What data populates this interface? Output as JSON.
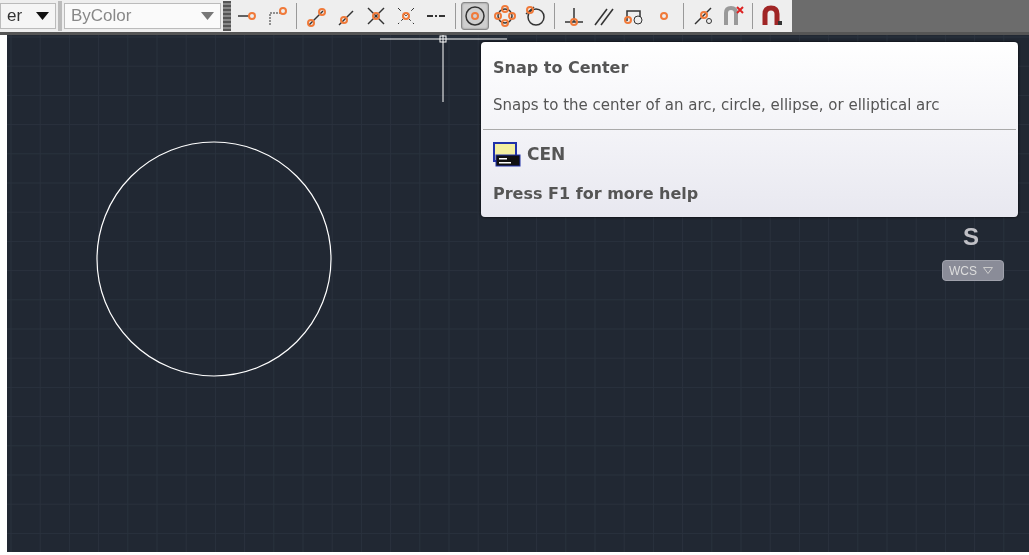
{
  "toolbar": {
    "layer_dropdown": {
      "value": "er"
    },
    "color_dropdown": {
      "value": "ByColor"
    },
    "snap_groups": [
      {
        "buttons": [
          {
            "kind": "endpoint",
            "selected": false
          },
          {
            "kind": "extension",
            "selected": false
          }
        ]
      },
      {
        "buttons": [
          {
            "kind": "midpoint",
            "selected": false
          },
          {
            "kind": "midpoint2",
            "selected": false
          },
          {
            "kind": "intersection",
            "selected": false
          },
          {
            "kind": "apparent",
            "selected": false
          },
          {
            "kind": "dashline",
            "selected": false
          }
        ]
      },
      {
        "buttons": [
          {
            "kind": "center",
            "selected": true
          },
          {
            "kind": "quadrant",
            "selected": false
          },
          {
            "kind": "tangent",
            "selected": false
          }
        ]
      },
      {
        "buttons": [
          {
            "kind": "perpendicular",
            "selected": false
          },
          {
            "kind": "parallel",
            "selected": false
          },
          {
            "kind": "insert",
            "selected": false
          },
          {
            "kind": "node",
            "selected": false
          }
        ]
      },
      {
        "buttons": [
          {
            "kind": "nearest",
            "selected": false
          },
          {
            "kind": "none",
            "selected": false
          }
        ]
      },
      {
        "buttons": [
          {
            "kind": "magnet",
            "selected": false
          }
        ]
      }
    ]
  },
  "tooltip": {
    "title": "Snap to Center",
    "description": "Snaps to the center of an arc, circle, ellipse, or elliptical arc",
    "command": "CEN",
    "help": "Press F1 for more help"
  },
  "viewcube": {
    "label": "S"
  },
  "coordinate_system": {
    "label": "WCS"
  }
}
